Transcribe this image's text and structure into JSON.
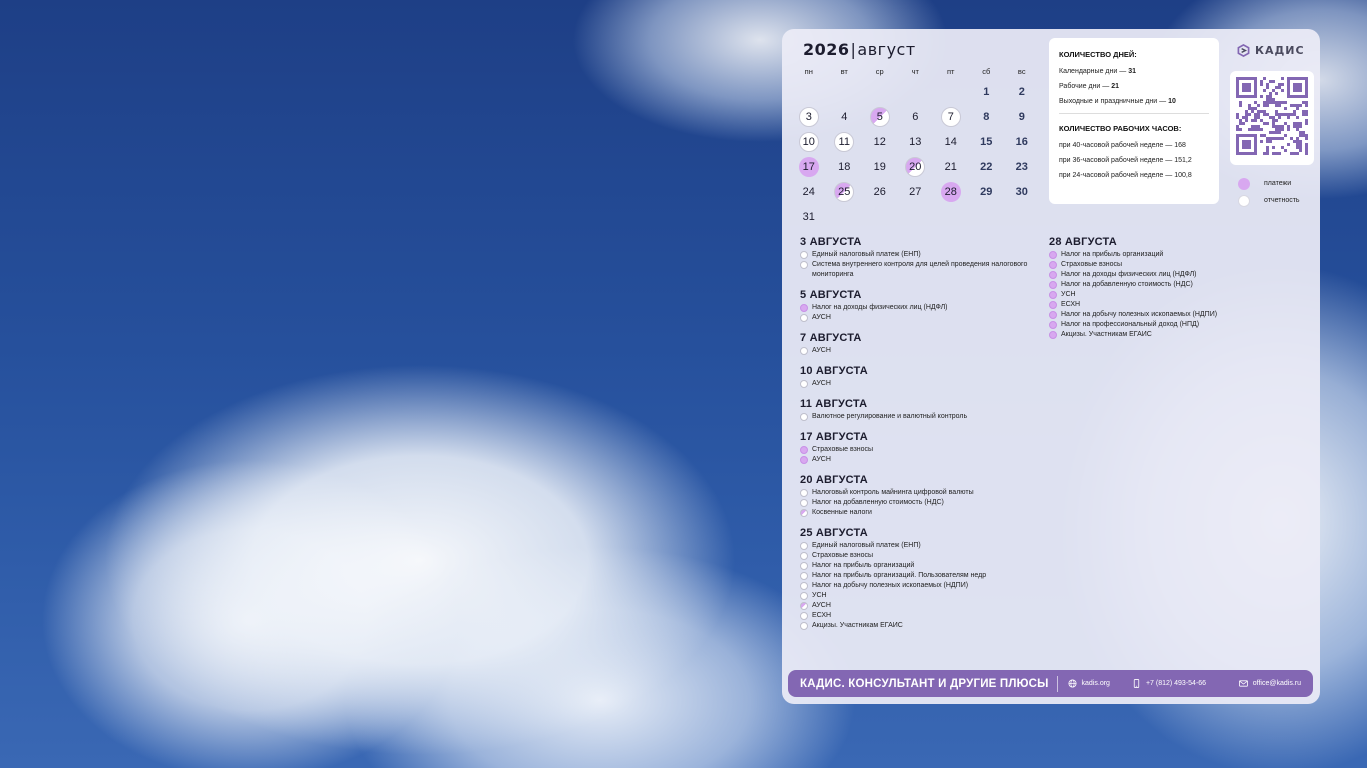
{
  "calendar": {
    "year": "2026",
    "month": "август",
    "weekdays": [
      "пн",
      "вт",
      "ср",
      "чт",
      "пт",
      "сб",
      "вс"
    ],
    "weeks": [
      [
        null,
        null,
        null,
        null,
        null,
        {
          "d": "1",
          "type": "weekend"
        },
        {
          "d": "2",
          "type": "weekend"
        }
      ],
      [
        {
          "d": "3",
          "type": "report"
        },
        {
          "d": "4"
        },
        {
          "d": "5",
          "type": "half"
        },
        {
          "d": "6"
        },
        {
          "d": "7",
          "type": "report"
        },
        {
          "d": "8",
          "type": "weekend"
        },
        {
          "d": "9",
          "type": "weekend"
        }
      ],
      [
        {
          "d": "10",
          "type": "report"
        },
        {
          "d": "11",
          "type": "report"
        },
        {
          "d": "12"
        },
        {
          "d": "13"
        },
        {
          "d": "14"
        },
        {
          "d": "15",
          "type": "weekend"
        },
        {
          "d": "16",
          "type": "weekend"
        }
      ],
      [
        {
          "d": "17",
          "type": "payment"
        },
        {
          "d": "18"
        },
        {
          "d": "19"
        },
        {
          "d": "20",
          "type": "half"
        },
        {
          "d": "21"
        },
        {
          "d": "22",
          "type": "weekend"
        },
        {
          "d": "23",
          "type": "weekend"
        }
      ],
      [
        {
          "d": "24"
        },
        {
          "d": "25",
          "type": "half"
        },
        {
          "d": "26"
        },
        {
          "d": "27"
        },
        {
          "d": "28",
          "type": "payment"
        },
        {
          "d": "29",
          "type": "weekend"
        },
        {
          "d": "30",
          "type": "weekend"
        }
      ],
      [
        {
          "d": "31"
        },
        null,
        null,
        null,
        null,
        null,
        null
      ]
    ]
  },
  "stats": {
    "days_heading": "КОЛИЧЕСТВО ДНЕЙ:",
    "calendar_days_label": "Календарные дни —",
    "calendar_days_value": "31",
    "working_days_label": "Рабочие дни —",
    "working_days_value": "21",
    "weekend_days_label": "Выходные и праздничные дни —",
    "weekend_days_value": "10",
    "hours_heading": "КОЛИЧЕСТВО РАБОЧИХ ЧАСОВ:",
    "hours": [
      "при 40-часовой рабочей неделе — 168",
      "при 36-часовой рабочей неделе — 151,2",
      "при 24-часовой рабочей неделе — 100,8"
    ]
  },
  "brand": {
    "name": "КАДИС",
    "accent": "#8367b3",
    "payment_color": "#d8a8f0"
  },
  "legend": {
    "payments": "платежи",
    "reports": "отчетность"
  },
  "events_left": [
    {
      "date": "3 АВГУСТА",
      "items": [
        {
          "text": "Единый налоговый платеж (ЕНП)",
          "type": "report"
        },
        {
          "text": "Система внутреннего контроля для целей проведения налогового мониторинга",
          "type": "report"
        }
      ]
    },
    {
      "date": "5 АВГУСТА",
      "items": [
        {
          "text": "Налог на доходы физических лиц (НДФЛ)",
          "type": "payment"
        },
        {
          "text": "АУСН",
          "type": "report"
        }
      ]
    },
    {
      "date": "7 АВГУСТА",
      "items": [
        {
          "text": "АУСН",
          "type": "report"
        }
      ]
    },
    {
      "date": "10 АВГУСТА",
      "items": [
        {
          "text": "АУСН",
          "type": "report"
        }
      ]
    },
    {
      "date": "11 АВГУСТА",
      "items": [
        {
          "text": "Валютное регулирование и валютный контроль",
          "type": "report"
        }
      ]
    },
    {
      "date": "17 АВГУСТА",
      "items": [
        {
          "text": "Страховые взносы",
          "type": "payment"
        },
        {
          "text": "АУСН",
          "type": "payment"
        }
      ]
    },
    {
      "date": "20 АВГУСТА",
      "items": [
        {
          "text": "Налоговый контроль майнинга цифровой валюты",
          "type": "report"
        },
        {
          "text": "Налог на добавленную стоимость (НДС)",
          "type": "report"
        },
        {
          "text": "Косвенные налоги",
          "type": "half"
        }
      ]
    },
    {
      "date": "25 АВГУСТА",
      "items": [
        {
          "text": "Единый налоговый платеж (ЕНП)",
          "type": "report"
        },
        {
          "text": "Страховые взносы",
          "type": "report"
        },
        {
          "text": "Налог на прибыль организаций",
          "type": "report"
        },
        {
          "text": "Налог на прибыль организаций. Пользователям недр",
          "type": "report"
        },
        {
          "text": "Налог на добычу полезных ископаемых (НДПИ)",
          "type": "report"
        },
        {
          "text": "УСН",
          "type": "report"
        },
        {
          "text": "АУСН",
          "type": "half"
        },
        {
          "text": "ЕСХН",
          "type": "report"
        },
        {
          "text": "Акцизы. Участникам ЕГАИС",
          "type": "report"
        }
      ]
    }
  ],
  "events_right": [
    {
      "date": "28 АВГУСТА",
      "items": [
        {
          "text": "Налог на прибыль организаций",
          "type": "payment"
        },
        {
          "text": "Страховые взносы",
          "type": "payment"
        },
        {
          "text": "Налог на доходы физических лиц (НДФЛ)",
          "type": "payment"
        },
        {
          "text": "Налог на добавленную стоимость (НДС)",
          "type": "payment"
        },
        {
          "text": "УСН",
          "type": "payment"
        },
        {
          "text": "ЕСХН",
          "type": "payment"
        },
        {
          "text": "Налог на добычу полезных ископаемых (НДПИ)",
          "type": "payment"
        },
        {
          "text": "Налог на профессиональный доход (НПД)",
          "type": "payment"
        },
        {
          "text": "Акцизы. Участникам ЕГАИС",
          "type": "payment"
        }
      ]
    }
  ],
  "footer": {
    "title": "КАДИС. КОНСУЛЬТАНТ И ДРУГИЕ ПЛЮСЫ",
    "site": "kadis.org",
    "phone": "+7 (812) 493-54-66",
    "email": "office@kadis.ru"
  }
}
